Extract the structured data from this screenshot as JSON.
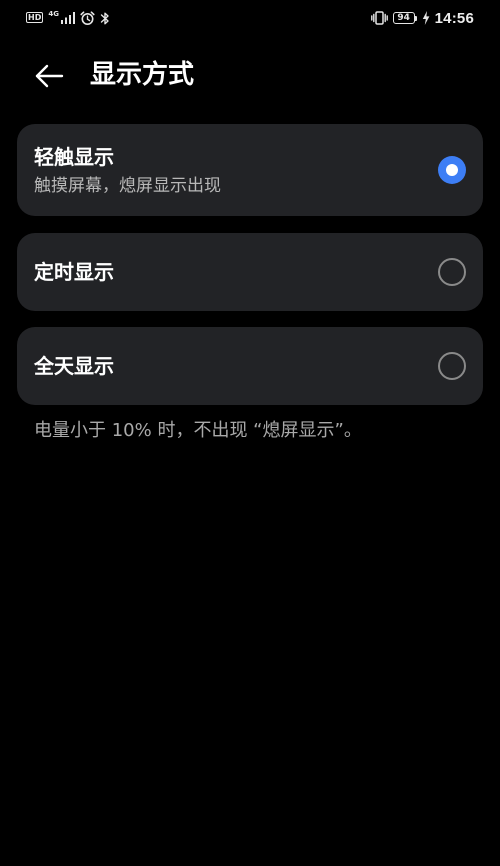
{
  "status_bar": {
    "hd_label": "HD",
    "network_label": "4G",
    "battery_level": "94",
    "time": "14:56"
  },
  "header": {
    "title": "显示方式"
  },
  "options": [
    {
      "title": "轻触显示",
      "subtitle": "触摸屏幕，熄屏显示出现",
      "selected": true
    },
    {
      "title": "定时显示",
      "selected": false
    },
    {
      "title": "全天显示",
      "selected": false
    }
  ],
  "footnote": "电量小于 10% 时，不出现 “熄屏显示”。",
  "colors": {
    "background": "#000000",
    "card": "#222326",
    "accent": "#3d7ef5",
    "secondary_text": "#b8b8b8"
  },
  "icons": {
    "back": "arrow-left-icon",
    "signal": "signal-bars-icon",
    "alarm": "alarm-clock-icon",
    "bluetooth": "bluetooth-icon",
    "vibrate": "vibrate-icon",
    "charging": "lightning-icon"
  }
}
